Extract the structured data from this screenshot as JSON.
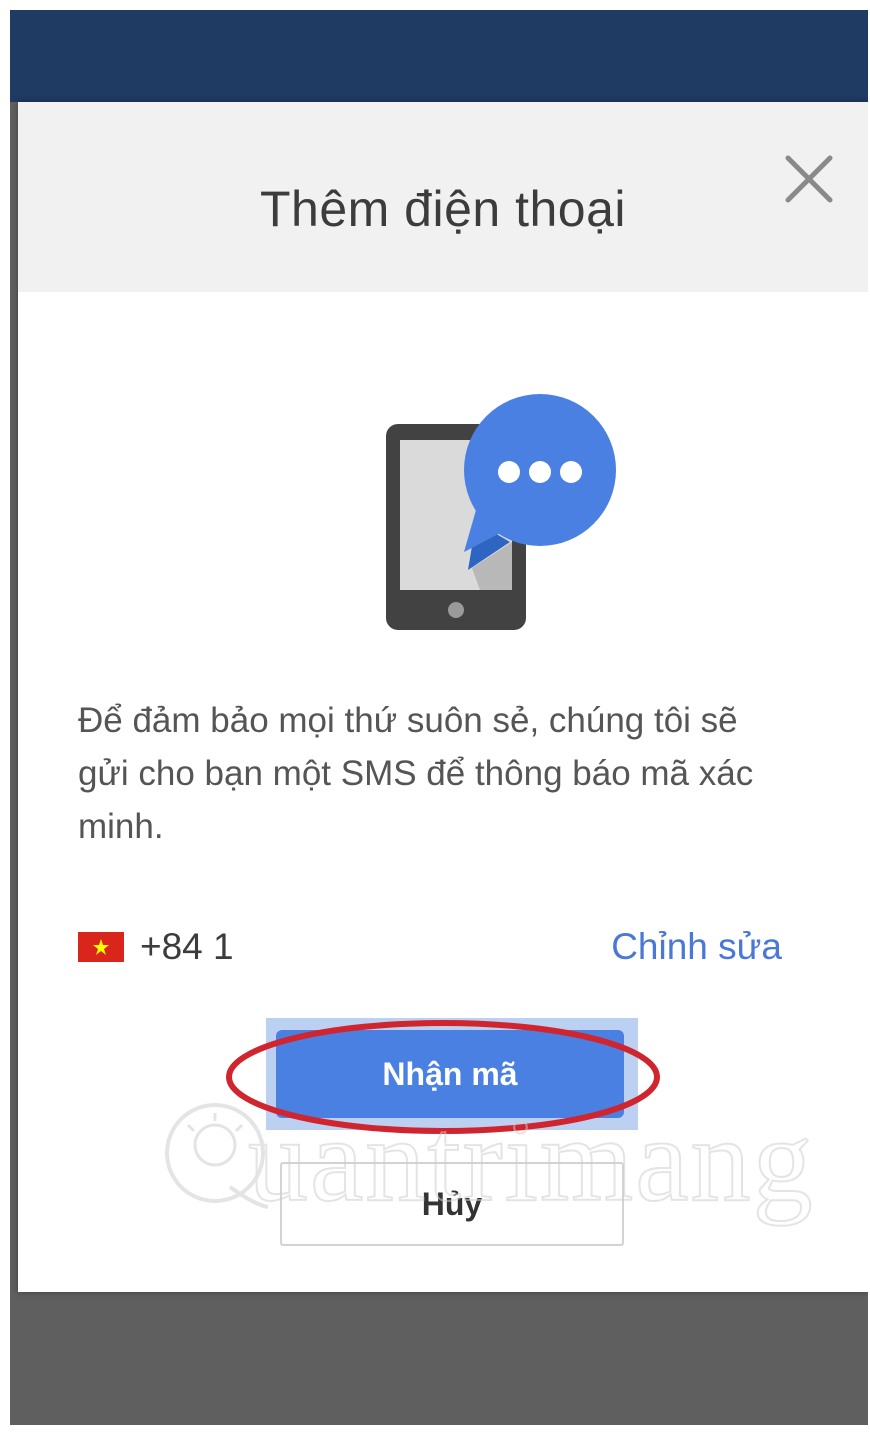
{
  "dialog": {
    "title": "Thêm điện thoại",
    "description": "Để đảm bảo mọi thứ suôn sẻ, chúng tôi sẽ gửi cho bạn một SMS để thông báo mã xác minh.",
    "phone": {
      "country_flag": "vietnam-flag-icon",
      "number": "+84 1",
      "edit_label": "Chỉnh sửa"
    },
    "primary_button": "Nhận mã",
    "secondary_button": "Hủy"
  },
  "watermark": {
    "text": "uantrimang"
  },
  "colors": {
    "topbar": "#1f3a63",
    "accent": "#4a80e2",
    "link": "#4a78d8",
    "annotation": "#d0252e",
    "backdrop": "#5f5f5f"
  }
}
